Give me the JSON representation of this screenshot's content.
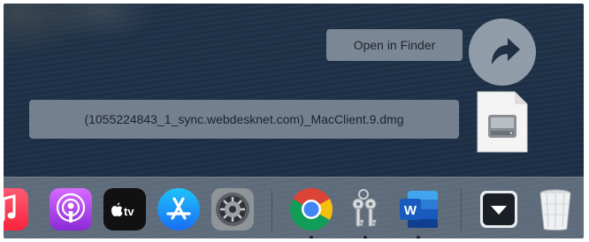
{
  "tooltip": {
    "open_in_finder": "Open in Finder"
  },
  "download": {
    "filename": "(1055224843_1_sync.webdesknet.com)_MacClient.9.dmg",
    "action_icon": "share-arrow-icon",
    "file_icon": "dmg-disk-image-icon"
  },
  "dock": {
    "apps": [
      {
        "name": "Music",
        "icon": "music-icon",
        "running": false
      },
      {
        "name": "Podcasts",
        "icon": "podcasts-icon",
        "running": false
      },
      {
        "name": "TV",
        "icon": "apple-tv-icon",
        "label": "tv",
        "running": false
      },
      {
        "name": "App Store",
        "icon": "app-store-icon",
        "running": false
      },
      {
        "name": "System Preferences",
        "icon": "system-preferences-icon",
        "running": false
      },
      {
        "name": "Google Chrome",
        "icon": "chrome-icon",
        "running": true
      },
      {
        "name": "Keychain Access",
        "icon": "keychain-icon",
        "running": true
      },
      {
        "name": "Microsoft Word",
        "icon": "word-icon",
        "label": "W",
        "running": true
      },
      {
        "name": "Downloads",
        "icon": "downloads-stack-icon",
        "running": false
      },
      {
        "name": "Trash",
        "icon": "trash-icon",
        "running": false
      }
    ]
  },
  "colors": {
    "podcasts": "#a443e0",
    "app_store": "#1b8cf5",
    "word": "#1e5fbd",
    "chrome_red": "#db4437",
    "chrome_yellow": "#f4c20d",
    "chrome_green": "#0f9d58",
    "chrome_blue": "#4285f4"
  }
}
